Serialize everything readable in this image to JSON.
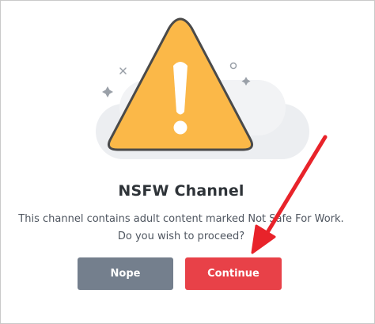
{
  "modal": {
    "title": "NSFW Channel",
    "message_line1": "This channel contains adult content marked Not Safe For Work.",
    "message_line2": "Do you wish to proceed?",
    "nope_label": "Nope",
    "continue_label": "Continue"
  },
  "icons": {
    "illustration": "warning-triangle-icon",
    "annotation": "red-arrow-icon"
  },
  "colors": {
    "warning_fill": "#fbb848",
    "nope_button": "#747f8d",
    "continue_button": "#e84148",
    "annotation_arrow": "#e8232a"
  }
}
